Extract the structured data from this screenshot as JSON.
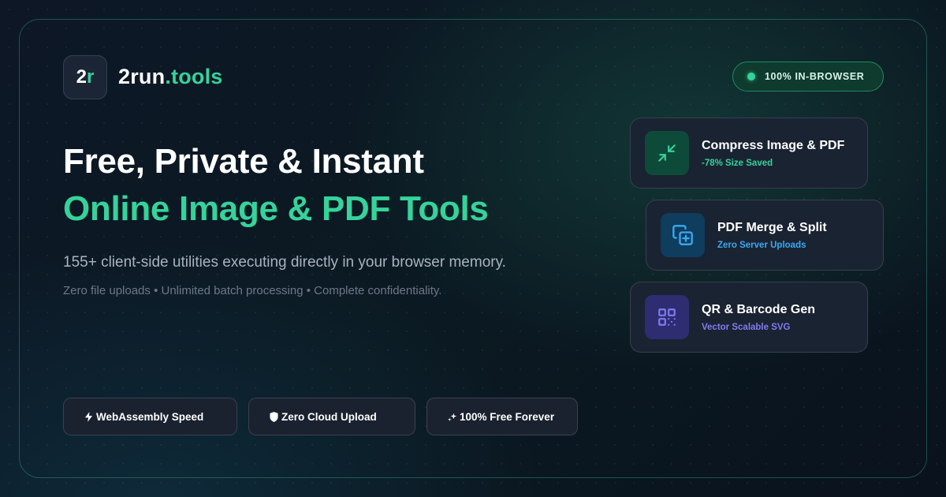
{
  "brand": {
    "logo_mark_main": "2",
    "logo_mark_accent": "r",
    "name_main": "2run",
    "name_accent": ".tools",
    "accent_color": "#35d39a"
  },
  "badge": {
    "label": "100% IN-BROWSER"
  },
  "hero": {
    "headline_line1": "Free, Private & Instant",
    "headline_line2": "Online Image & PDF Tools",
    "subtitle": "155+ client-side utilities executing directly in your browser memory.",
    "features_line": "Zero file uploads • Unlimited batch processing • Complete confidentiality."
  },
  "tools": [
    {
      "title": "Compress Image & PDF",
      "meta": "-78% Size Saved",
      "icon": "compress-icon",
      "icon_bg": "#0e4a3a",
      "meta_color": "#35d39a"
    },
    {
      "title": "PDF Merge & Split",
      "meta": "Zero Server Uploads",
      "icon": "merge-icon",
      "icon_bg": "#0e3d5e",
      "meta_color": "#3aa9f2"
    },
    {
      "title": "QR & Barcode Gen",
      "meta": "Vector Scalable SVG",
      "icon": "qr-code-icon",
      "icon_bg": "#2f2d72",
      "meta_color": "#7f7cf0"
    }
  ],
  "pills": [
    {
      "label": "WebAssembly Speed",
      "icon": "lightning-icon"
    },
    {
      "label": "Zero Cloud Upload",
      "icon": "shield-icon"
    },
    {
      "label": "100% Free Forever",
      "icon": "sparkle-icon"
    }
  ]
}
